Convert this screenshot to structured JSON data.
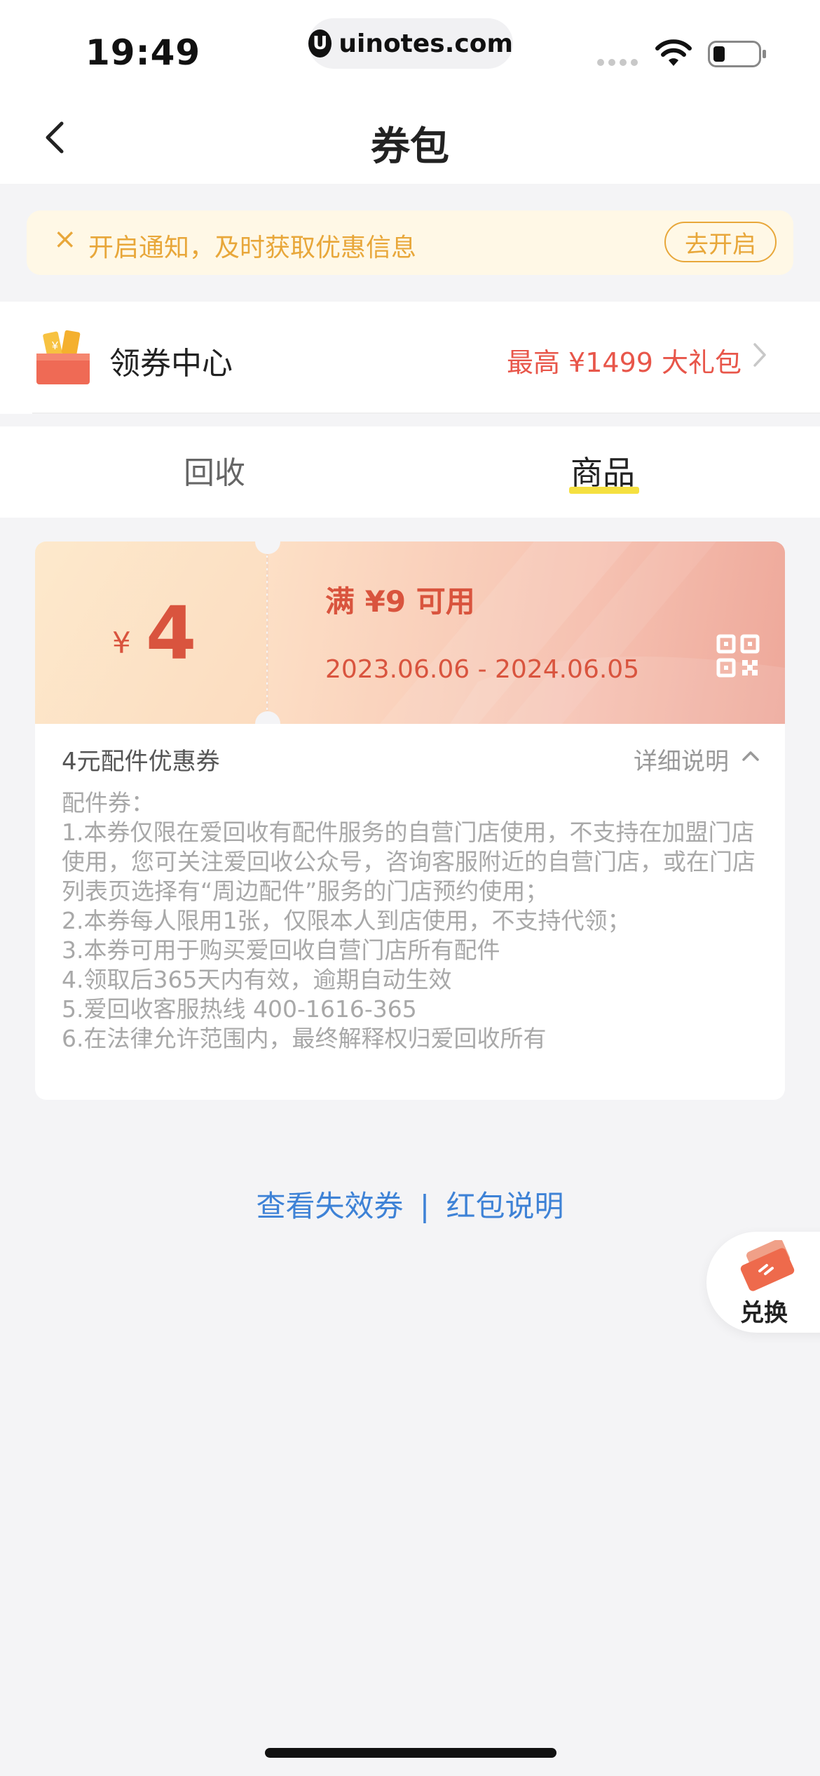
{
  "status_bar": {
    "time": "19:49",
    "url_logo": "U",
    "url": "uinotes.com"
  },
  "nav": {
    "title": "券包",
    "back_icon": "chevron-left-icon"
  },
  "notice": {
    "close_icon": "×",
    "text": "开启通知，及时获取优惠信息",
    "button": "去开启",
    "color": "#e8a73a"
  },
  "coupon_center": {
    "label": "领券中心",
    "promo": "最高 ¥1499 大礼包",
    "icon": "gift-box-icon"
  },
  "tabs": [
    {
      "label": "回收",
      "active": false
    },
    {
      "label": "商品",
      "active": true
    }
  ],
  "coupon": {
    "currency": "¥",
    "amount": "4",
    "condition": "满 ¥9 可用",
    "date_range": "2023.06.06 - 2024.06.05",
    "accent": "#d9543e"
  },
  "details": {
    "name": "4元配件优惠券",
    "toggle": "详细说明",
    "lines": [
      "配件券：",
      "1.本券仅限在爱回收有配件服务的自营门店使用，不支持在加盟门店使用，您可关注爱回收公众号，咨询客服附近的自营门店，或在门店列表页选择有“周边配件”服务的门店预约使用；",
      "2.本券每人限用1张，仅限本人到店使用，不支持代领；",
      "3.本券可用于购买爱回收自营门店所有配件",
      "4.领取后365天内有效，逾期自动生效",
      "5.爱回收客服热线 400-1616-365",
      "6.在法律允许范围内，最终解释权归爱回收所有"
    ]
  },
  "footer": {
    "expired_link": "查看失效券",
    "separator": "|",
    "info_link": "红包说明",
    "link_color": "#3e82d6"
  },
  "exchange": {
    "label": "兑换"
  }
}
